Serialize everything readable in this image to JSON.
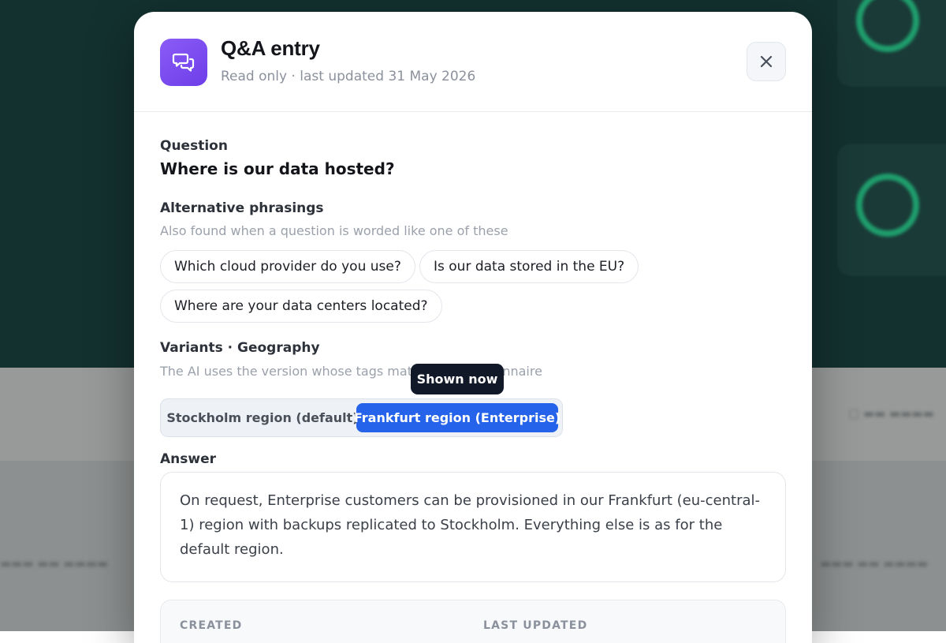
{
  "modal": {
    "title": "Q&A entry",
    "subtitle": "Read only · last updated 31 May 2026",
    "app_icon": "chat-bubbles-icon",
    "close_icon": "close-icon"
  },
  "question": {
    "label": "Question",
    "text": "Where is our data hosted?"
  },
  "alternatives": {
    "label": "Alternative phrasings",
    "hint": "Also found when a question is worded like one of these",
    "items": [
      "Which cloud provider do you use?",
      "Is our data stored in the EU?",
      "Where are your data centers located?"
    ]
  },
  "variants": {
    "label": "Variants · Geography",
    "hint": "The AI uses the version whose tags match the questionnaire",
    "options": [
      {
        "label": "Stockholm region (default)",
        "selected": false
      },
      {
        "label": "Frankfurt region (Enterprise)",
        "selected": true
      }
    ],
    "tooltip": "Shown now"
  },
  "answer": {
    "label": "Answer",
    "text": "On request, Enterprise customers can be provisioned in our Frankfurt (eu-central-1) region with backups replicated to Stockholm. Everything else is as for the default region."
  },
  "meta": {
    "created_label": "CREATED",
    "updated_label": "LAST UPDATED"
  },
  "colors": {
    "accent": "#2563eb",
    "icon_bg": "#7c4dff",
    "tooltip_bg": "#111827"
  }
}
